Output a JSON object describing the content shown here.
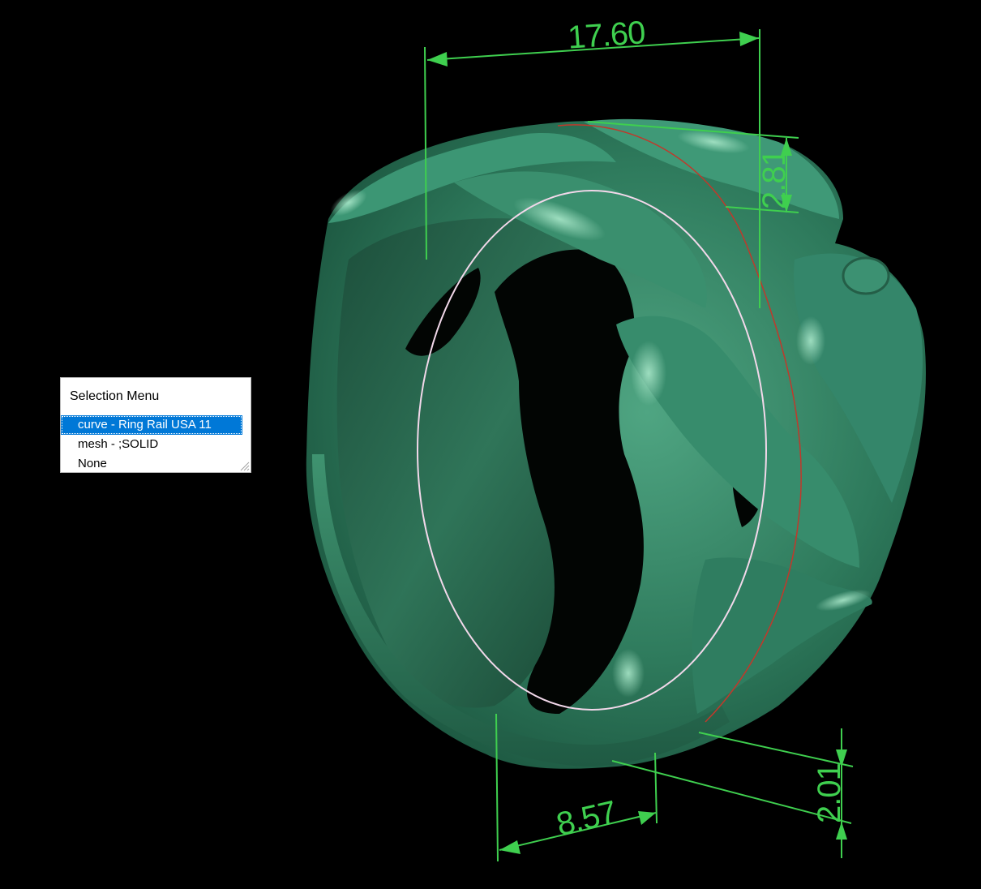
{
  "dimensions": {
    "top_width": "17.60",
    "top_height": "2.81",
    "bottom_width": "8.57",
    "bottom_height": "2.01"
  },
  "selection_menu": {
    "title": "Selection Menu",
    "items": [
      {
        "label": "curve - Ring Rail USA 11",
        "selected": true
      },
      {
        "label": "mesh - ;SOLID",
        "selected": false
      },
      {
        "label": "None",
        "selected": false
      }
    ]
  },
  "colors": {
    "background": "#000000",
    "model": "#2f7d5f",
    "dimension": "#3fcf4f",
    "rail_curve": "#f2d8ea",
    "seam_curve": "#c0392b",
    "selection": "#0078d7"
  }
}
